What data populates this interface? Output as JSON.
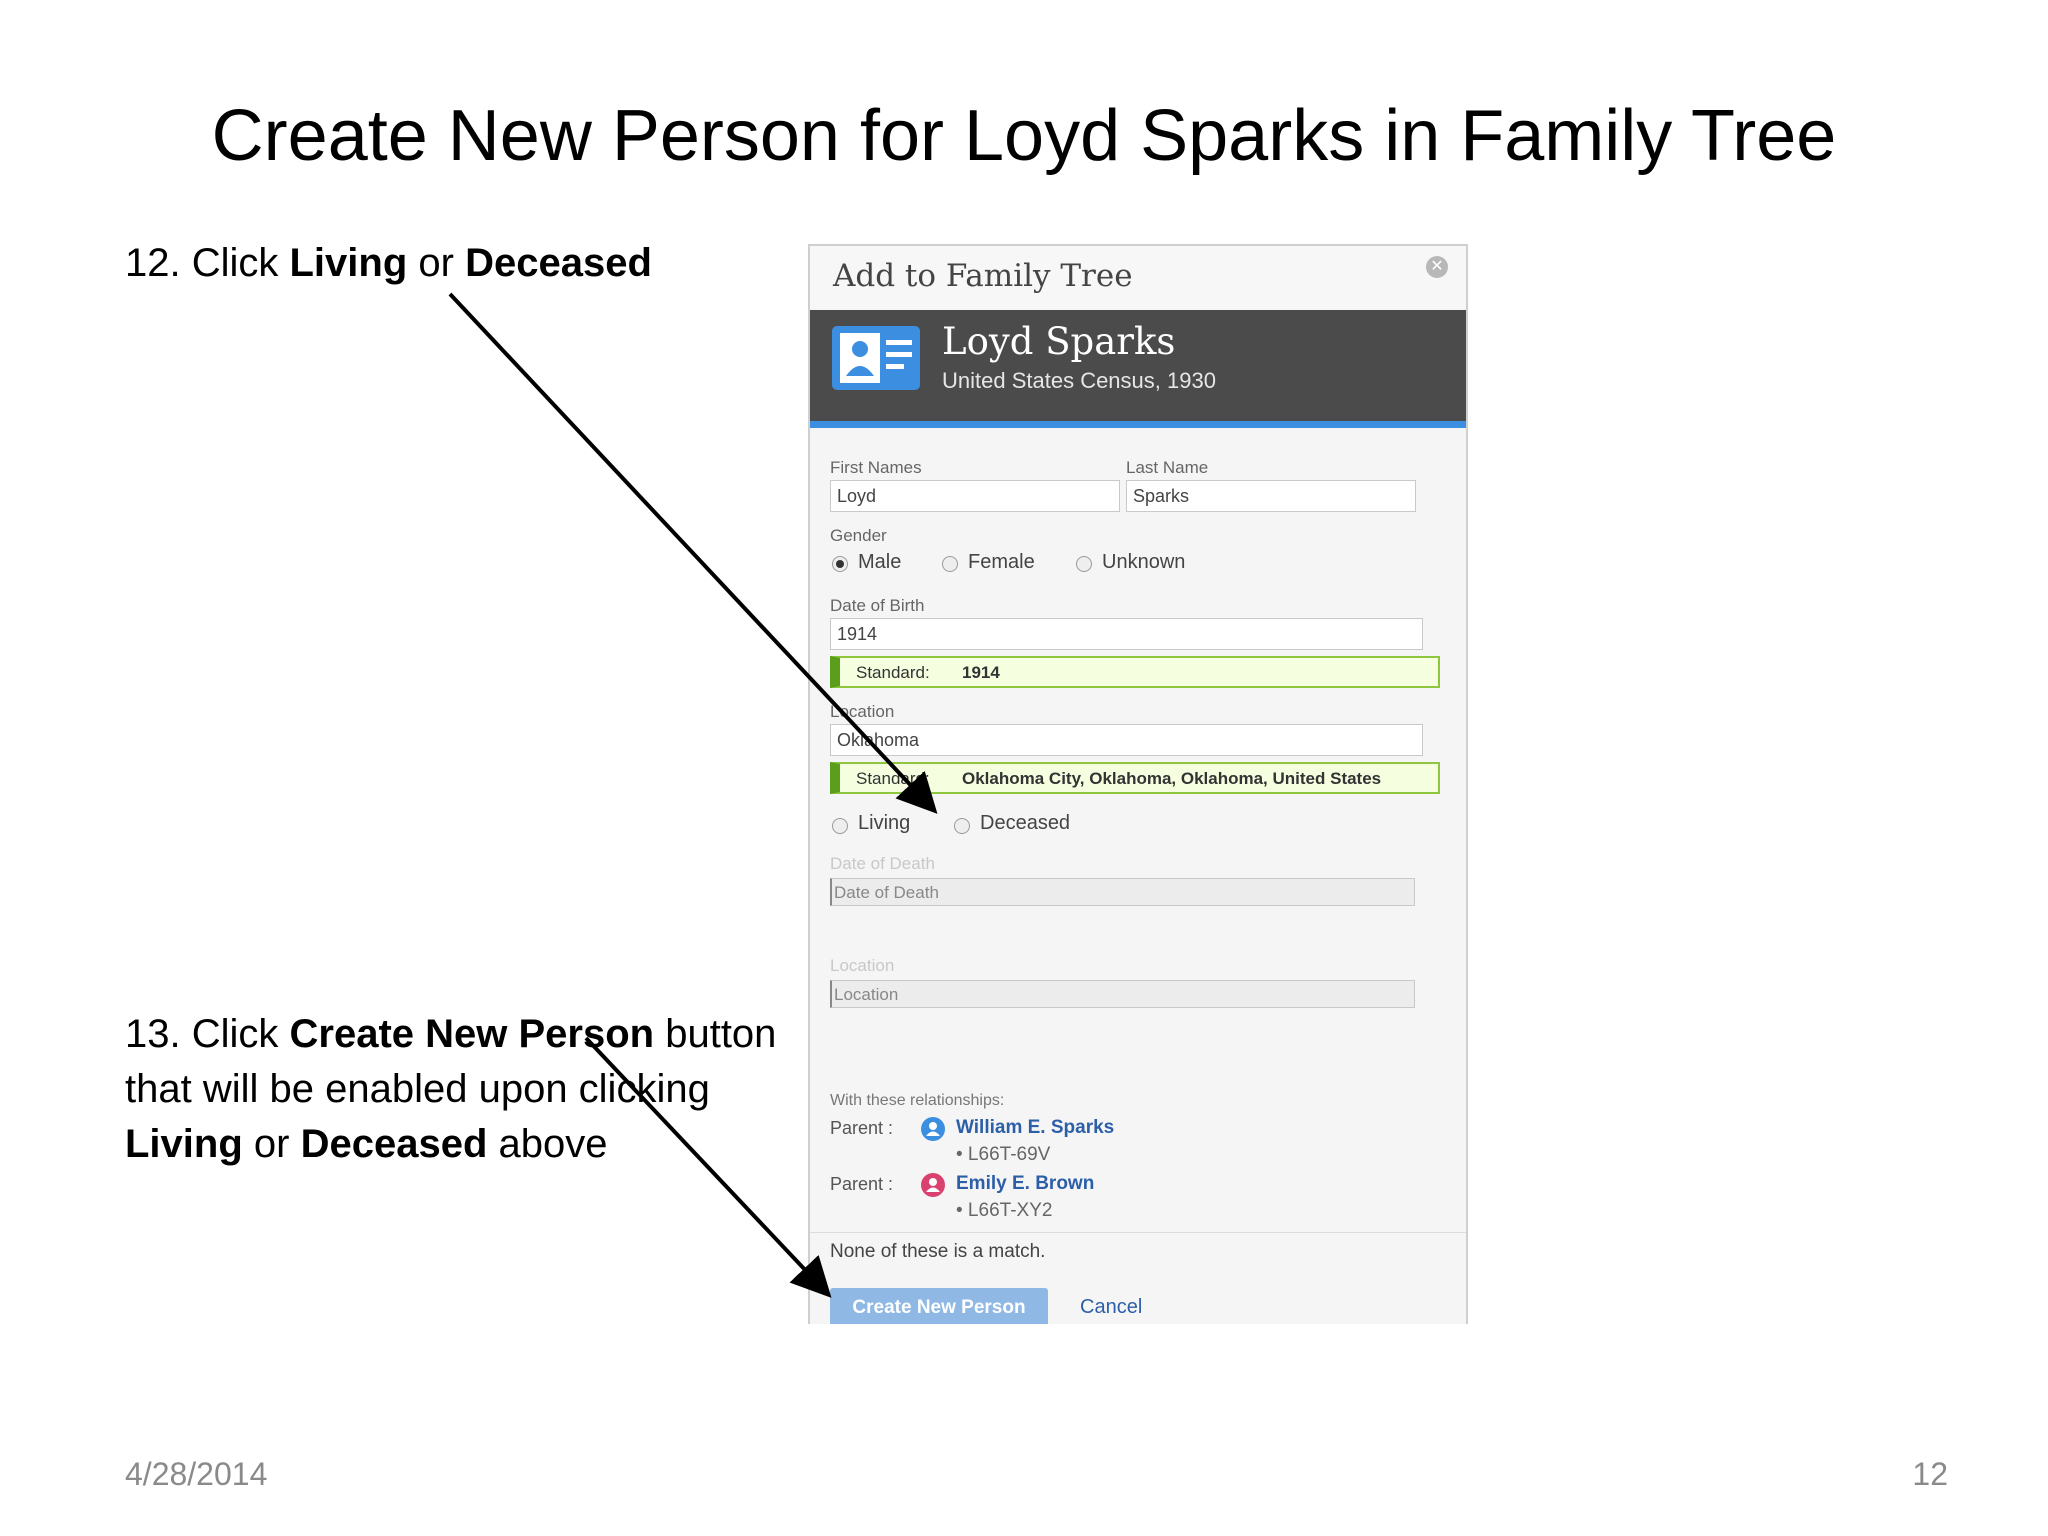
{
  "slide": {
    "title": "Create New Person for Loyd Sparks in Family Tree",
    "step12": {
      "prefix": "12. Click ",
      "living": "Living",
      "or": " or ",
      "deceased": "Deceased"
    },
    "step13": {
      "prefix": "13. Click ",
      "button": "Create New Person",
      "suffix": " button that will be enabled upon clicking ",
      "living": "Living",
      "or": " or ",
      "deceased": "Deceased",
      "end": " above"
    },
    "footer_date": "4/28/2014",
    "footer_page": "12"
  },
  "dialog": {
    "title": "Add to Family Tree",
    "close_icon": "close-icon",
    "person_name": "Loyd Sparks",
    "person_source": "United States Census, 1930",
    "first_names_label": "First Names",
    "first_names_value": "Loyd",
    "last_name_label": "Last Name",
    "last_name_value": "Sparks",
    "gender_label": "Gender",
    "gender_options": [
      "Male",
      "Female",
      "Unknown"
    ],
    "gender_selected": "Male",
    "dob_label": "Date of Birth",
    "dob_value": "1914",
    "dob_standard_key": "Standard:",
    "dob_standard_value": "1914",
    "location_label": "Location",
    "location_value": "Oklahoma",
    "location_standard_key": "Standard:",
    "location_standard_value": "Oklahoma City, Oklahoma, Oklahoma, United States",
    "status_options": [
      "Living",
      "Deceased"
    ],
    "death_date_label": "Date of Death",
    "death_date_placeholder": "Date of Death",
    "death_location_label": "Location",
    "death_location_placeholder": "Location",
    "relationships_label": "With these relationships:",
    "parents": [
      {
        "label": "Parent :",
        "name": "William E. Sparks",
        "id": "• L66T-69V",
        "color": "#3b8ee0"
      },
      {
        "label": "Parent :",
        "name": "Emily E. Brown",
        "id": "• L66T-XY2",
        "color": "#d9426e"
      }
    ],
    "none_match": "None of these is a match.",
    "create_button": "Create New Person",
    "cancel_link": "Cancel"
  },
  "colors": {
    "accent": "#3b8ee0",
    "standard_border": "#8ec63f",
    "button_disabled": "#8fb8e4",
    "link": "#2c5fa8"
  }
}
